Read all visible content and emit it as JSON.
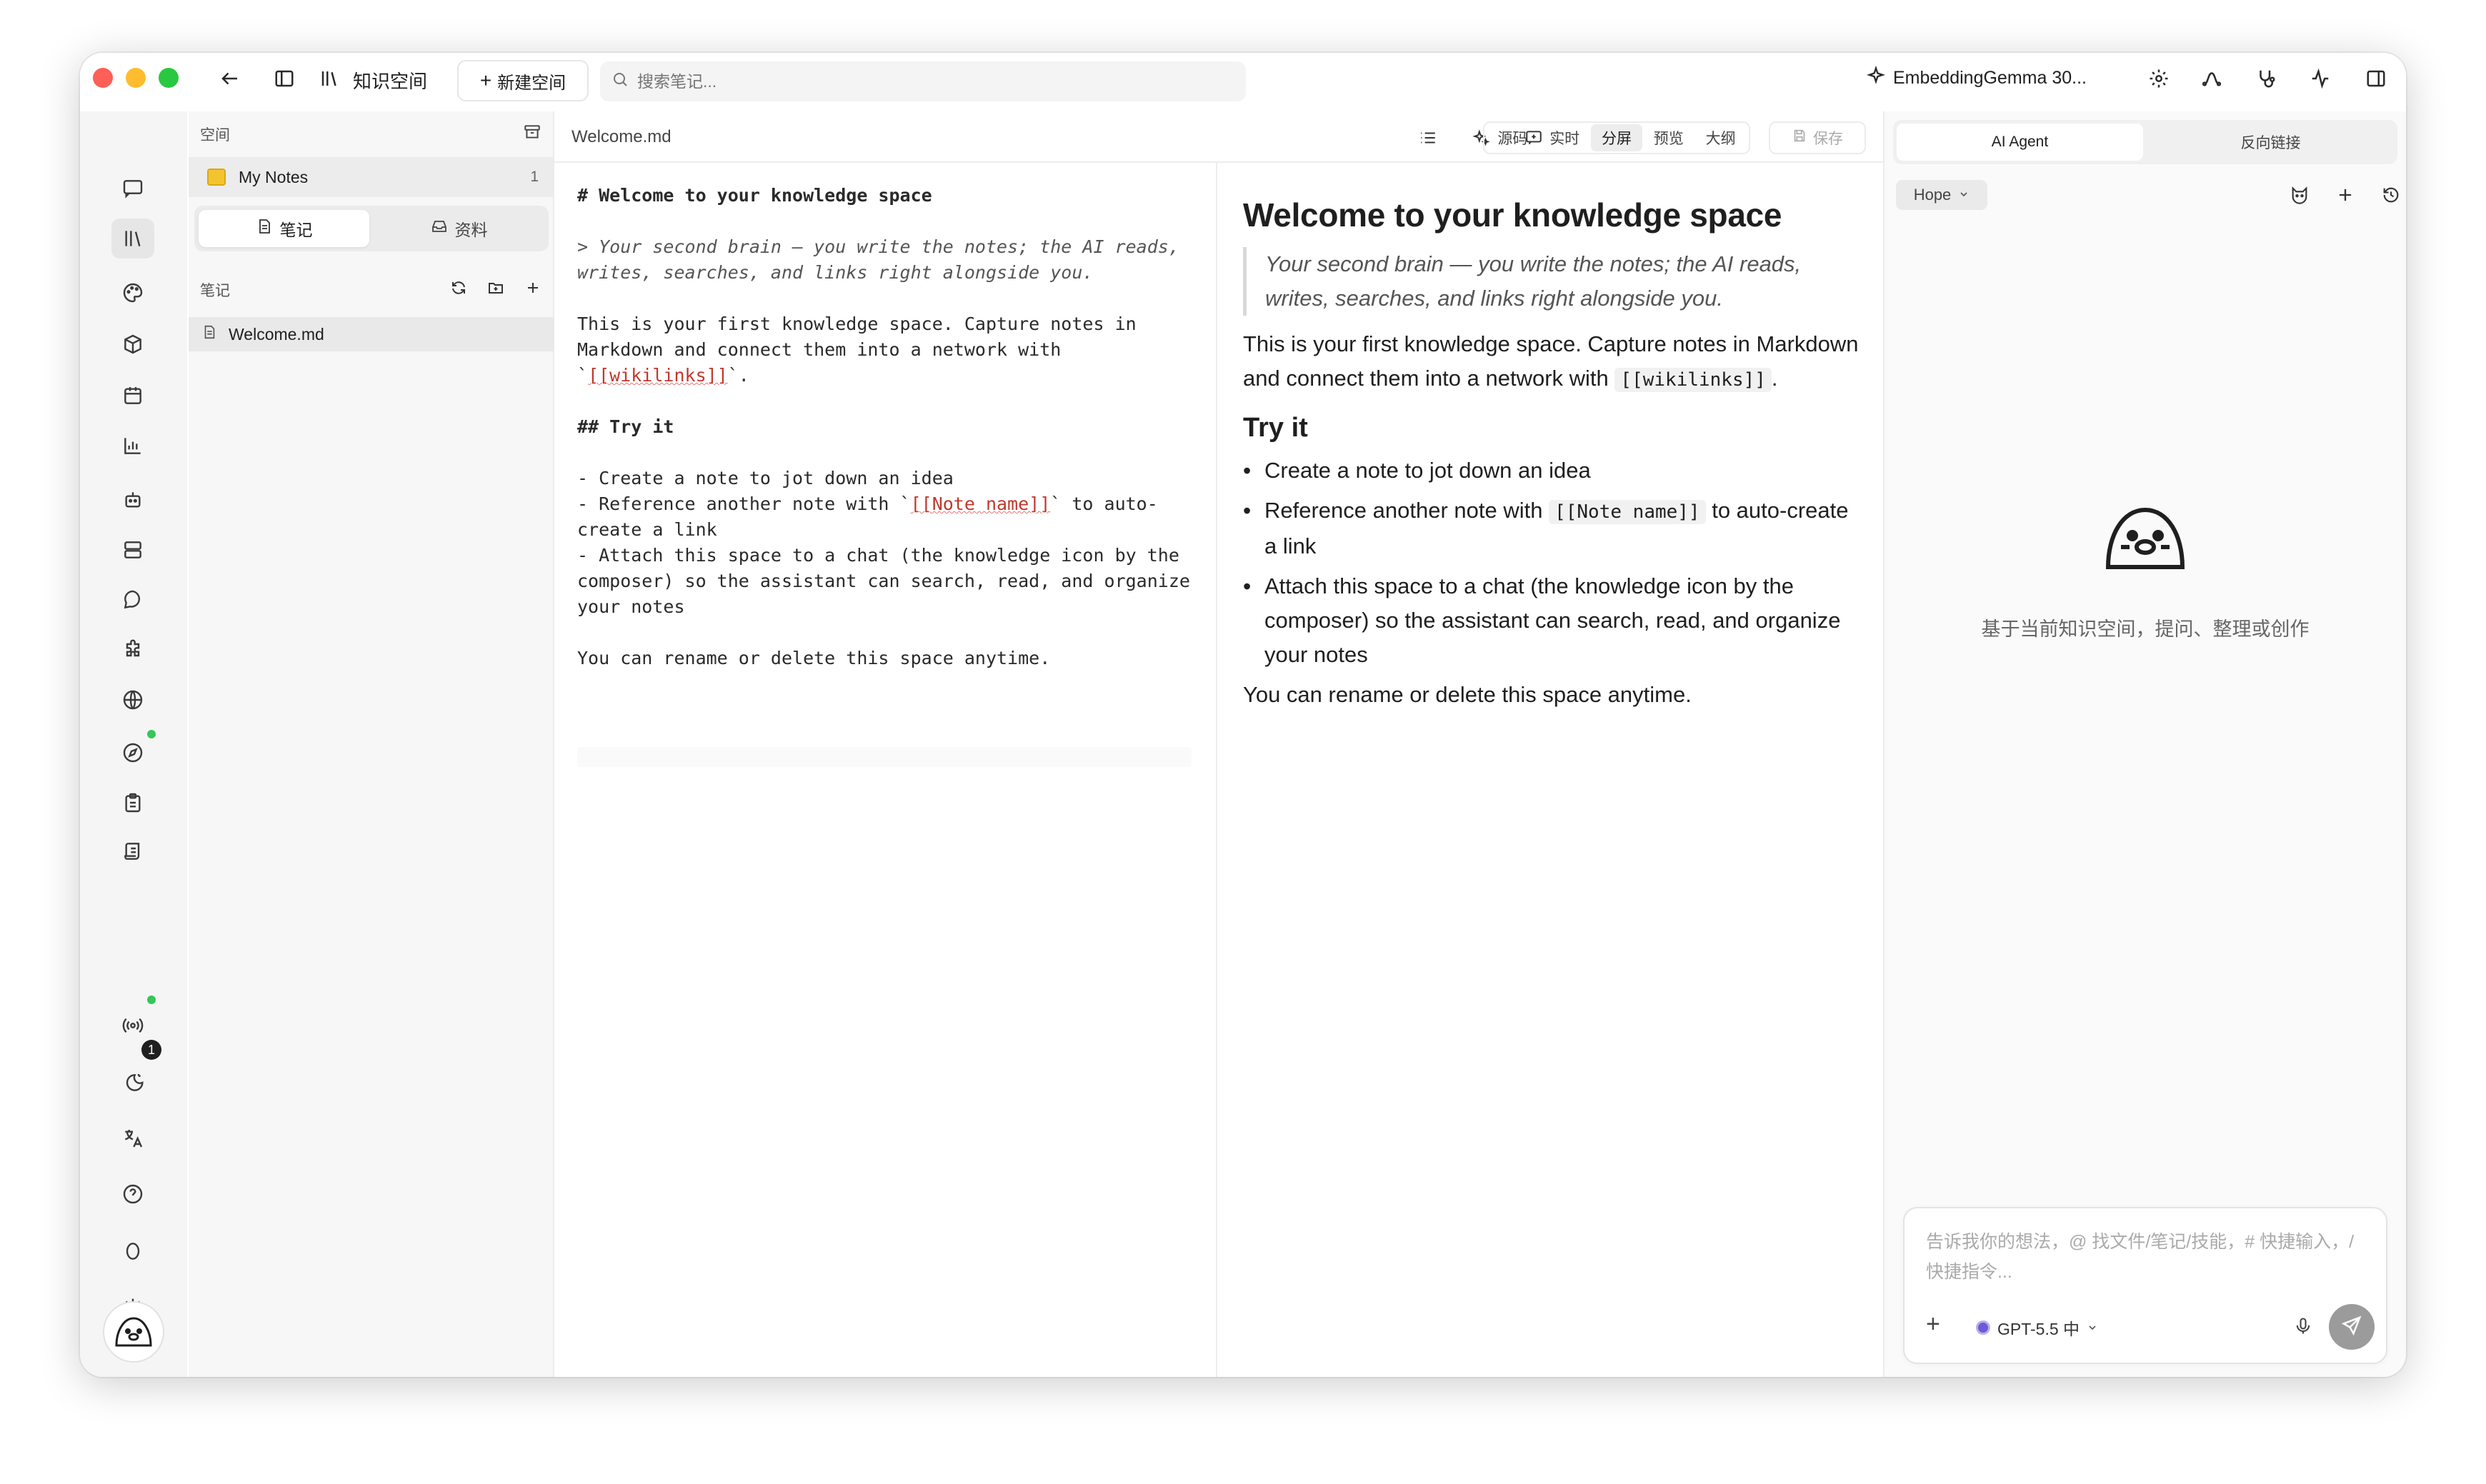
{
  "titlebar": {
    "title": "知识空间",
    "new_space_label": "新建空间",
    "search_placeholder": "搜索笔记...",
    "model_status": "EmbeddingGemma 30..."
  },
  "rail": {
    "badge_count": "1"
  },
  "notes_panel": {
    "space_header": "空间",
    "space_name": "My Notes",
    "space_count": "1",
    "tabs": [
      "笔记",
      "资料"
    ],
    "notes_header": "笔记",
    "files": [
      "Welcome.md"
    ]
  },
  "editor": {
    "filename": "Welcome.md",
    "modes": [
      "源码",
      "实时",
      "分屏",
      "预览",
      "大纲"
    ],
    "active_mode": "分屏",
    "save_label": "保存",
    "source": {
      "h1": "# Welcome to your knowledge space",
      "quote": "> Your second brain — you write the notes; the AI reads, writes, searches, and links right alongside you.",
      "p1_pre": "This is your first knowledge space. Capture notes in Markdown and connect them into a network with `",
      "p1_link": "[[wikilinks]]",
      "p1_post": "`.",
      "h2": "## Try it",
      "li1": "- Create a note to jot down an idea",
      "li2_pre": "- Reference another note with `",
      "li2_link": "[[Note name]]",
      "li2_post": "` to auto-create a link",
      "li3": "- Attach this space to a chat (the knowledge icon by the composer) so the assistant can search, read, and organize your notes",
      "p2": "You can rename or delete this space anytime."
    },
    "preview": {
      "h1": "Welcome to your knowledge space",
      "quote": "Your second brain — you write the notes; the AI reads, writes, searches, and links right alongside you.",
      "p1": "This is your first knowledge space. Capture notes in Markdown and connect them into a network with",
      "p1_code": "[[wikilinks]]",
      "p1_end": ".",
      "h2": "Try it",
      "li1": "Create a note to jot down an idea",
      "li2_pre": "Reference another note with",
      "li2_code": "[[Note name]]",
      "li2_post": "to auto-create a link",
      "li3": "Attach this space to a chat (the knowledge icon by the composer) so the assistant can search, read, and organize your notes",
      "p2": "You can rename or delete this space anytime."
    }
  },
  "ai_panel": {
    "tabs": [
      "AI Agent",
      "反向链接"
    ],
    "active_tab": "AI Agent",
    "persona": "Hope",
    "empty_text": "基于当前知识空间，提问、整理或创作",
    "composer_placeholder": "告诉我你的想法，@ 找文件/笔记/技能，# 快捷输入，/ 快捷指令...",
    "model": "GPT-5.5 中"
  },
  "colors": {
    "close": "#fe5f57",
    "minimize": "#febc2e",
    "zoom": "#28c840",
    "status_green": "#34c759",
    "wikilink": "#c0392b"
  }
}
